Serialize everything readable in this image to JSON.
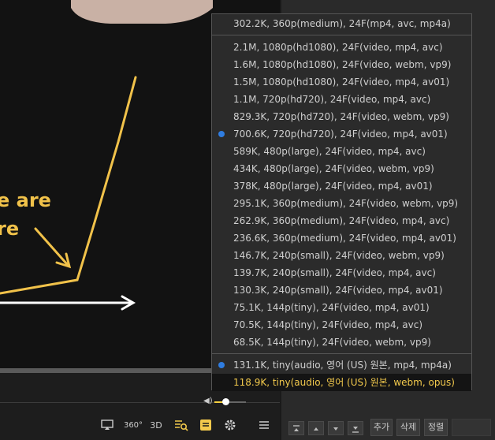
{
  "quality_menu": {
    "top_item": "302.2K, 360p(medium), 24F(mp4, avc, mp4a)",
    "video_items": [
      "2.1M, 1080p(hd1080), 24F(video, mp4, avc)",
      "1.6M, 1080p(hd1080), 24F(video, webm, vp9)",
      "1.5M, 1080p(hd1080), 24F(video, mp4, av01)",
      "1.1M, 720p(hd720), 24F(video, mp4, avc)",
      "829.3K, 720p(hd720), 24F(video, webm, vp9)",
      "700.6K, 720p(hd720), 24F(video, mp4, av01)",
      "589K, 480p(large), 24F(video, mp4, avc)",
      "434K, 480p(large), 24F(video, webm, vp9)",
      "378K, 480p(large), 24F(video, mp4, av01)",
      "295.1K, 360p(medium), 24F(video, webm, vp9)",
      "262.9K, 360p(medium), 24F(video, mp4, avc)",
      "236.6K, 360p(medium), 24F(video, mp4, av01)",
      "146.7K, 240p(small), 24F(video, webm, vp9)",
      "139.7K, 240p(small), 24F(video, mp4, avc)",
      "130.3K, 240p(small), 24F(video, mp4, av01)",
      "75.1K, 144p(tiny), 24F(video, mp4, av01)",
      "70.5K, 144p(tiny), 24F(video, mp4, avc)",
      "68.5K, 144p(tiny), 24F(video, webm, vp9)"
    ],
    "audio_items": [
      "131.1K, tiny(audio, 영어 (US) 원본, mp4, mp4a)",
      "118.9K, tiny(audio, 영어 (US) 원본, webm, opus)"
    ],
    "selected_video": "700.6K, 720p(hd720), 24F(video, mp4, av01)",
    "selected_audio": "131.1K, tiny(audio, 영어 (US) 원본, mp4, mp4a)",
    "hovered": "118.9K, tiny(audio, 영어 (US) 원본, webm, opus)"
  },
  "video_overlay": {
    "line1": "e are",
    "line2": "re"
  },
  "controls": {
    "icons": [
      "airplay-icon",
      "360-icon",
      "3d-icon",
      "playlist-search-icon",
      "subtitle-icon",
      "settings-gear-icon",
      "menu-icon"
    ],
    "label_360": "360°",
    "label_3d": "3D",
    "volume_level": 0.35
  },
  "playlist_toolbar": {
    "buttons": [
      "추가",
      "삭제",
      "정렬"
    ]
  },
  "colors": {
    "accent_yellow": "#f2c94c",
    "radio_blue": "#2f7de1",
    "menu_bg": "#2b2b2b"
  }
}
